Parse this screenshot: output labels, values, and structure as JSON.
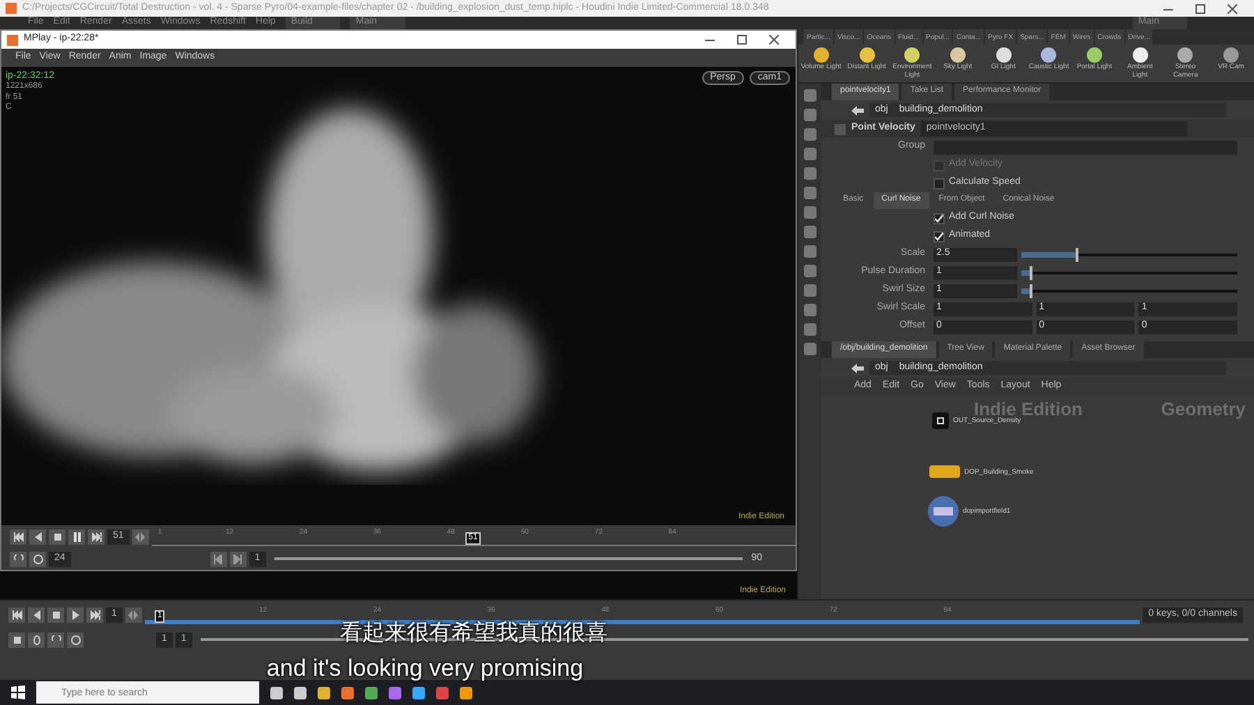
{
  "window": {
    "title": "C:/Projects/CGCircuit/Total Destruction - vol. 4 - Sparse Pyro/04-example-files/chapter 02 - /building_explosion_dust_temp.hiplc - Houdini Indie Limited-Commercial 18.0.348"
  },
  "menu": [
    "File",
    "Edit",
    "Render",
    "Assets",
    "Windows",
    "Redshift",
    "Help"
  ],
  "desktops": [
    "Build",
    "Main"
  ],
  "right_desktop": "Main",
  "mplay": {
    "title": "MPlay - ip-22:28*",
    "menu": [
      "File",
      "View",
      "Render",
      "Anim",
      "Image",
      "Windows"
    ],
    "overlay": [
      "ip-22:32:12",
      "1221x686",
      "fr 51",
      "C"
    ],
    "views": [
      "Persp",
      "cam1"
    ],
    "watermark": "Indie Edition",
    "timeline": {
      "frame": "51",
      "marker": "51",
      "ticks": [
        "1",
        "12",
        "24",
        "36",
        "48",
        "60",
        "72",
        "84"
      ],
      "fps": "24",
      "start": "1",
      "end": "90"
    }
  },
  "lower_viewport": {
    "watermark": "Indie Edition"
  },
  "main_timeline": {
    "frame": "1",
    "marker": "1",
    "ticks": [
      "12",
      "24",
      "36",
      "48",
      "60",
      "72",
      "84"
    ],
    "start": "1",
    "range_start": "1",
    "keys": "0 keys, 0/0 channels"
  },
  "shelf": {
    "tabs": [
      "Partic...",
      "Visco...",
      "Oceans",
      "Fluid...",
      "Popul...",
      "Conta...",
      "Pyro FX",
      "Spars...",
      "FEM",
      "Wires",
      "Crowds",
      "Drive..."
    ],
    "tools": [
      "Volume Light",
      "Distant Light",
      "Environment Light",
      "Sky Light",
      "GI Light",
      "Caustic Light",
      "Portal Light",
      "Ambient Light",
      "Stereo Camera",
      "VR Cam"
    ]
  },
  "params": {
    "tabs": [
      {
        "label": "pointvelocity1",
        "selected": true
      },
      {
        "label": "Take List",
        "selected": false
      },
      {
        "label": "Performance Monitor",
        "selected": false
      }
    ],
    "path": [
      "obj",
      "building_demolition"
    ],
    "node_type": "Point Velocity",
    "node_name": "pointvelocity1",
    "rows": [
      {
        "kind": "field",
        "label": "Group"
      },
      {
        "kind": "check",
        "label": "Add Velocity",
        "checked": false,
        "disabled": true
      },
      {
        "kind": "check",
        "label": "Calculate Speed",
        "checked": false,
        "disabled": false
      }
    ],
    "subtabs": [
      {
        "label": "Basic",
        "selected": false
      },
      {
        "label": "Curl Noise",
        "selected": true
      },
      {
        "label": "From Object",
        "selected": false
      },
      {
        "label": "Conical Noise",
        "selected": false
      }
    ],
    "curl_rows": [
      {
        "kind": "check",
        "label": "Add Curl Noise",
        "checked": true,
        "disabled": false
      },
      {
        "kind": "check",
        "label": "Animated",
        "checked": true,
        "disabled": false
      },
      {
        "kind": "slider",
        "label": "Scale",
        "value": "2.5",
        "level": 0.25
      },
      {
        "kind": "slider",
        "label": "Pulse Duration",
        "value": "1",
        "level": 0.04
      },
      {
        "kind": "slider",
        "label": "Swirl Size",
        "value": "1",
        "level": 0.04
      },
      {
        "kind": "vector",
        "label": "Swirl Scale",
        "values": [
          "1",
          "1",
          "1"
        ]
      },
      {
        "kind": "vector",
        "label": "Offset",
        "values": [
          "0",
          "0",
          "0"
        ]
      }
    ]
  },
  "network": {
    "tabs": [
      {
        "label": "/obj/building_demolition",
        "selected": true
      },
      {
        "label": "Tree View",
        "selected": false
      },
      {
        "label": "Material Palette",
        "selected": false
      },
      {
        "label": "Asset Browser",
        "selected": false
      }
    ],
    "path": [
      "obj",
      "building_demolition"
    ],
    "menu": [
      "Add",
      "Edit",
      "Go",
      "View",
      "Tools",
      "Layout",
      "Help"
    ],
    "watermarks": [
      "Indie Edition",
      "Geometry"
    ],
    "nodes": [
      {
        "kind": "null",
        "name": "OUT_Source_Density"
      },
      {
        "kind": "dop",
        "name": "DOP_Building_Smoke"
      },
      {
        "kind": "import",
        "name": "dopimportfield1"
      }
    ]
  },
  "taskbar": {
    "search": {
      "placeholder": "Type here to search"
    }
  },
  "subtitles": [
    "看起来很有希望我真的很喜",
    "and it's looking very promising"
  ]
}
